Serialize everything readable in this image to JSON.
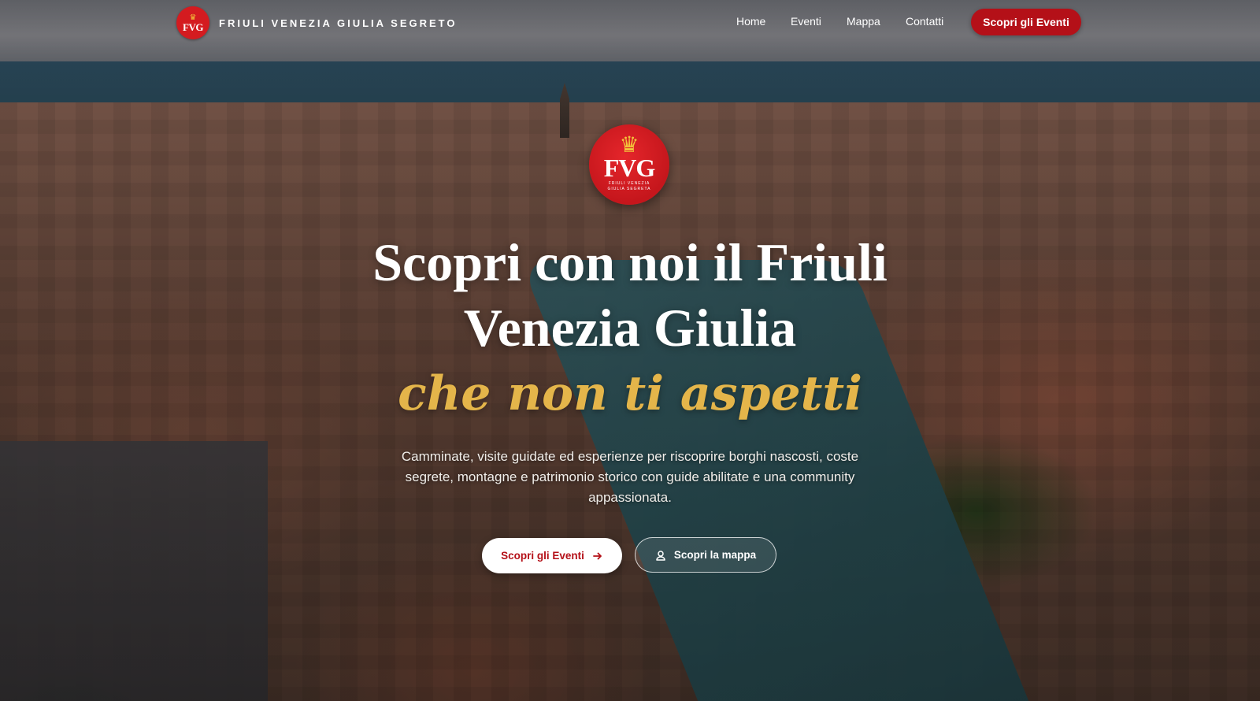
{
  "brand": {
    "name": "FRIULI VENEZIA GIULIA SEGRETO",
    "logo_abbr": "FVG",
    "logo_icon": "eagle-icon"
  },
  "nav": {
    "links": [
      "Home",
      "Eventi",
      "Mappa",
      "Contatti"
    ],
    "cta_label": "Scopri gli Eventi",
    "cta_color": "#b41018"
  },
  "hero": {
    "emblem": {
      "abbr": "FVG",
      "tagline": "FRIULI VENEZIA GIULIA SEGRETA",
      "icon": "eagle-icon"
    },
    "title_line1": "Scopri con noi il Friuli",
    "title_line2": "Venezia Giulia",
    "title_accent": "che non ti aspetti",
    "accent_color": "#e4b54a",
    "lead_line1": "Camminate, visite guidate ed esperienze per riscoprire borghi nascosti, coste",
    "lead_line2": "segrete, montagne e patrimonio storico con guide abilitate e una community",
    "lead_line3": "appassionata.",
    "primary_button": {
      "label": "Scopri gli Eventi",
      "icon": "arrow-right-icon"
    },
    "secondary_button": {
      "label": "Scopri la mappa",
      "icon": "user-location-icon"
    }
  }
}
